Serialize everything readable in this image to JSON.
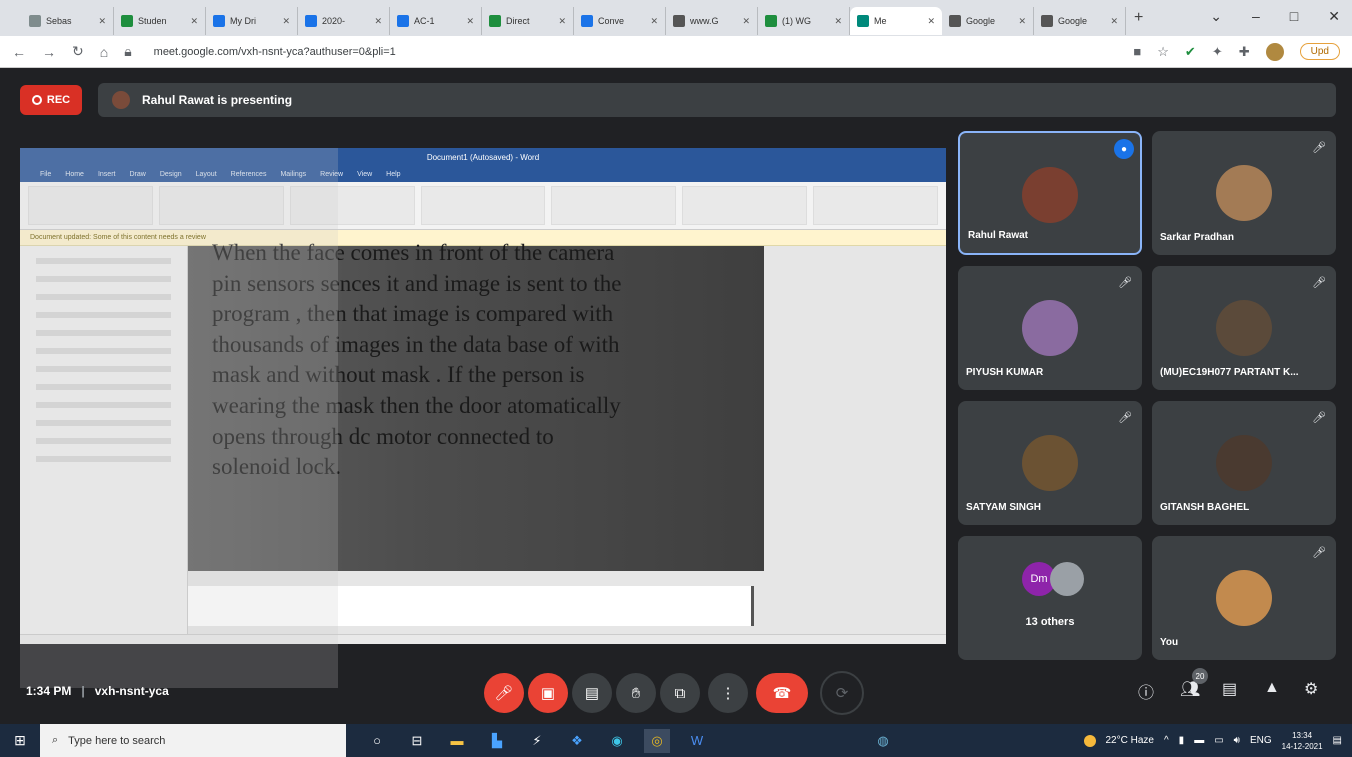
{
  "browser": {
    "tabs": [
      {
        "label": "Sebas",
        "color": "#7f8c8d"
      },
      {
        "label": "Studen",
        "color": "#1e8e3e"
      },
      {
        "label": "My Dri",
        "color": "#1a73e8"
      },
      {
        "label": "2020-",
        "color": "#1a73e8"
      },
      {
        "label": "AC-1",
        "color": "#1a73e8"
      },
      {
        "label": "Direct",
        "color": "#1e8e3e"
      },
      {
        "label": "Conve",
        "color": "#1a73e8"
      },
      {
        "label": "www.G",
        "color": "#555555"
      },
      {
        "label": "(1) WG",
        "color": "#1e8e3e"
      },
      {
        "label": "Me",
        "color": "#00897b",
        "active": true
      },
      {
        "label": "Google",
        "color": "#555555"
      },
      {
        "label": "Google",
        "color": "#555555"
      }
    ],
    "url": "meet.google.com/vxh-nsnt-yca?authuser=0&pli=1",
    "update_label": "Upd"
  },
  "meet": {
    "rec_label": "REC",
    "presenting_text": "Rahul Rawat is presenting",
    "time": "1:34 PM",
    "meeting_code": "vxh-nsnt-yca",
    "people_count": "20"
  },
  "shared_doc": {
    "title": "Document1 (Autosaved) - Word",
    "tabs": [
      "File",
      "Home",
      "Insert",
      "Draw",
      "Design",
      "Layout",
      "References",
      "Mailings",
      "Review",
      "View",
      "Help"
    ],
    "message_bar": "Document updated: Some of this content needs a review",
    "lines": [
      "When the face comes in front of the camera",
      "pin sensors sences it and image is sent to the",
      "program , then that image is compared with",
      "thousands of images in the data base of with",
      "mask and without mask . If the person is",
      "wearing the mask then the door atomatically",
      "opens through dc motor connected to",
      "solenoid lock."
    ]
  },
  "participants": [
    {
      "name": "Rahul Rawat",
      "avatar_color": "#7a3f30",
      "speaking": true
    },
    {
      "name": "Sarkar Pradhan",
      "avatar_color": "#a37b55"
    },
    {
      "name": "PIYUSH KUMAR",
      "avatar_color": "#8a6ba0"
    },
    {
      "name": "(MU)EC19H077 PARTANT K...",
      "avatar_color": "#5b4a3a"
    },
    {
      "name": "SATYAM SINGH",
      "avatar_color": "#6b5233"
    },
    {
      "name": "GITANSH BAGHEL",
      "avatar_color": "#4a3a30"
    },
    {
      "others_label": "13 others",
      "initials": "Dm",
      "initials_color": "#8e24aa"
    },
    {
      "name": "You",
      "avatar_color": "#c28a4e"
    }
  ],
  "taskbar": {
    "search_placeholder": "Type here to search",
    "weather": "22°C Haze",
    "lang": "ENG",
    "time": "13:34",
    "date": "14-12-2021"
  }
}
